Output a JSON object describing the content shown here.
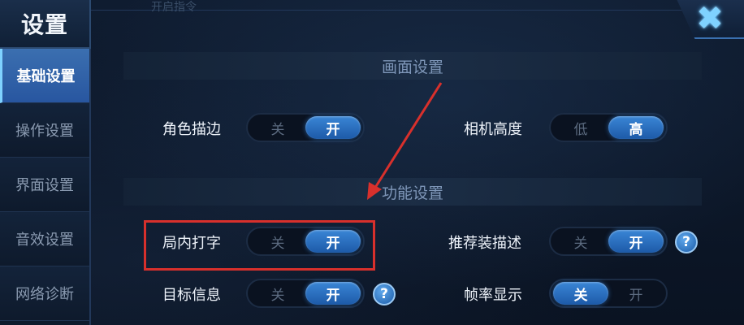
{
  "header": {
    "title": "设置",
    "faint_title": "开启指令"
  },
  "close": {
    "icon": "close-x-icon",
    "glyph": "✖"
  },
  "sidebar": {
    "items": [
      {
        "label": "基础设置",
        "active": true
      },
      {
        "label": "操作设置",
        "active": false
      },
      {
        "label": "界面设置",
        "active": false
      },
      {
        "label": "音效设置",
        "active": false
      },
      {
        "label": "网络诊断",
        "active": false
      }
    ]
  },
  "sections": {
    "display": {
      "title": "画面设置"
    },
    "function": {
      "title": "功能设置"
    }
  },
  "settings": {
    "role_outline": {
      "label": "角色描边",
      "left": "关",
      "right": "开",
      "selected": "开"
    },
    "camera_height": {
      "label": "相机高度",
      "left": "低",
      "right": "高",
      "selected": "高"
    },
    "in_game_typing": {
      "label": "局内打字",
      "left": "关",
      "right": "开",
      "selected": "开"
    },
    "recommended_gear": {
      "label": "推荐装描述",
      "left": "关",
      "right": "开",
      "selected": "开"
    },
    "target_info": {
      "label": "目标信息",
      "left": "关",
      "right": "开",
      "selected": "开"
    },
    "frame_rate": {
      "label": "帧率显示",
      "left": "关",
      "right": "开",
      "selected": "关"
    }
  },
  "help_glyph": "?",
  "colors": {
    "accent": "#2f78c8",
    "highlight": "#d8302c",
    "panel": "#0b1526"
  }
}
